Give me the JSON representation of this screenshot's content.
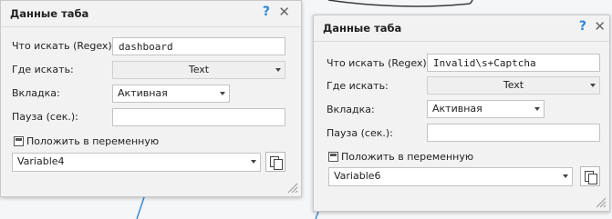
{
  "left_panel": {
    "title": "Данные таба",
    "help_icon": "?",
    "close_icon": "✕",
    "search_label": "Что искать (Regex):",
    "search_value": "dashboard",
    "where_label": "Где искать:",
    "where_value": "Text",
    "tab_label": "Вкладка:",
    "tab_value": "Активная",
    "pause_label": "Пауза (сек.):",
    "pause_value": "",
    "save_label": "Положить в переменную",
    "variable_value": "Variable4"
  },
  "right_panel": {
    "title": "Данные таба",
    "help_icon": "?",
    "close_icon": "✕",
    "search_label": "Что искать (Regex):",
    "search_value": "Invalid\\s+Captcha",
    "where_label": "Где искать:",
    "where_value": "Text",
    "tab_label": "Вкладка:",
    "tab_value": "Активная",
    "pause_label": "Пауза (сек.):",
    "pause_value": "",
    "save_label": "Положить в переменную",
    "variable_value": "Variable6"
  },
  "colors": {
    "accent": "#2f86d4",
    "panel_bg": "#f2f2f2",
    "connector": "#3c8ad0"
  }
}
